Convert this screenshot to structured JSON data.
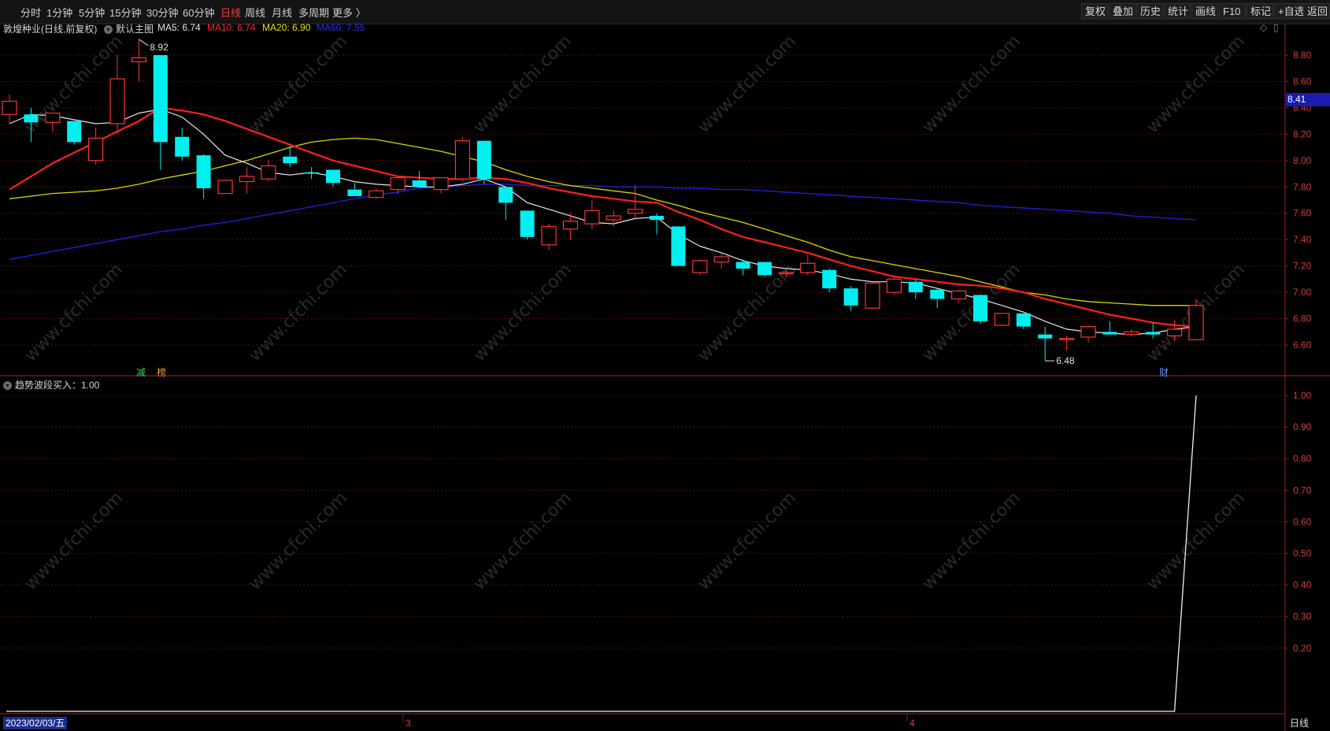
{
  "toolbar": {
    "periods": [
      "分时",
      "1分钟",
      "5分钟",
      "15分钟",
      "30分钟",
      "60分钟",
      "日线",
      "周线",
      "月线",
      "多周期",
      "更多 〉"
    ],
    "active_period": "日线",
    "right_buttons": [
      "复权",
      "叠加",
      "历史",
      "统计",
      "画线",
      "F10",
      "标记",
      "+自选",
      "返回"
    ]
  },
  "main_panel": {
    "stock_title": "敦煌种业(日线,前复权)",
    "indicator_name": "默认主图",
    "ma_labels": [
      {
        "text": "MA5: 6.74",
        "color": "#e8e8e8"
      },
      {
        "text": "MA10: 6.74",
        "color": "#ff2a2a"
      },
      {
        "text": "MA20: 6.90",
        "color": "#e6e600"
      },
      {
        "text": "MA60: 7.55",
        "color": "#2a2aff"
      }
    ],
    "y_ticks": [
      "8.80",
      "8.60",
      "8.40",
      "8.20",
      "8.00",
      "7.80",
      "7.60",
      "7.40",
      "7.20",
      "7.00",
      "6.80",
      "6.60"
    ],
    "current_price": "8.41",
    "high_label": "8.92",
    "low_label": "6.48",
    "badges": [
      {
        "text": "减",
        "color": "#3ecf5a"
      },
      {
        "text": "榜",
        "color": "#e89a3a"
      },
      {
        "text": "财",
        "color": "#6a8cff"
      }
    ]
  },
  "sub_panel": {
    "indicator_label": "趋势波段买入：1.00",
    "y_ticks": [
      "1.00",
      "0.90",
      "0.80",
      "0.70",
      "0.60",
      "0.50",
      "0.40",
      "0.30",
      "0.20"
    ]
  },
  "x_axis": {
    "current_date": "2023/02/03/五",
    "month_labels": [
      "3",
      "4"
    ],
    "period_label": "日线"
  },
  "watermark": "www.cfchi.com",
  "chart_data": {
    "type": "candlestick",
    "candles": [
      {
        "o": 8.35,
        "h": 8.5,
        "l": 8.28,
        "c": 8.45
      },
      {
        "o": 8.35,
        "h": 8.4,
        "l": 8.14,
        "c": 8.29
      },
      {
        "o": 8.29,
        "h": 8.36,
        "l": 8.22,
        "c": 8.36
      },
      {
        "o": 8.3,
        "h": 8.3,
        "l": 8.12,
        "c": 8.14
      },
      {
        "o": 8.0,
        "h": 8.25,
        "l": 7.97,
        "c": 8.17
      },
      {
        "o": 8.28,
        "h": 8.8,
        "l": 8.2,
        "c": 8.62
      },
      {
        "o": 8.75,
        "h": 8.92,
        "l": 8.6,
        "c": 8.78
      },
      {
        "o": 8.8,
        "h": 8.8,
        "l": 7.93,
        "c": 8.14
      },
      {
        "o": 8.18,
        "h": 8.25,
        "l": 8.0,
        "c": 8.03
      },
      {
        "o": 8.04,
        "h": 8.05,
        "l": 7.71,
        "c": 7.79
      },
      {
        "o": 7.75,
        "h": 7.85,
        "l": 7.75,
        "c": 7.85
      },
      {
        "o": 7.84,
        "h": 7.95,
        "l": 7.75,
        "c": 7.88
      },
      {
        "o": 7.86,
        "h": 8.0,
        "l": 7.84,
        "c": 7.96
      },
      {
        "o": 8.03,
        "h": 8.11,
        "l": 7.95,
        "c": 7.98
      },
      {
        "o": 7.91,
        "h": 7.95,
        "l": 7.86,
        "c": 7.9
      },
      {
        "o": 7.93,
        "h": 7.93,
        "l": 7.8,
        "c": 7.83
      },
      {
        "o": 7.78,
        "h": 7.83,
        "l": 7.75,
        "c": 7.73
      },
      {
        "o": 7.72,
        "h": 7.79,
        "l": 7.71,
        "c": 7.77
      },
      {
        "o": 7.78,
        "h": 7.88,
        "l": 7.75,
        "c": 7.87
      },
      {
        "o": 7.85,
        "h": 7.92,
        "l": 7.82,
        "c": 7.8
      },
      {
        "o": 7.78,
        "h": 7.87,
        "l": 7.75,
        "c": 7.87
      },
      {
        "o": 7.86,
        "h": 8.18,
        "l": 7.84,
        "c": 8.15
      },
      {
        "o": 8.15,
        "h": 8.15,
        "l": 7.82,
        "c": 7.86
      },
      {
        "o": 7.8,
        "h": 7.8,
        "l": 7.55,
        "c": 7.68
      },
      {
        "o": 7.62,
        "h": 7.62,
        "l": 7.4,
        "c": 7.42
      },
      {
        "o": 7.36,
        "h": 7.52,
        "l": 7.32,
        "c": 7.5
      },
      {
        "o": 7.48,
        "h": 7.6,
        "l": 7.4,
        "c": 7.54
      },
      {
        "o": 7.52,
        "h": 7.7,
        "l": 7.48,
        "c": 7.62
      },
      {
        "o": 7.55,
        "h": 7.62,
        "l": 7.5,
        "c": 7.58
      },
      {
        "o": 7.6,
        "h": 7.81,
        "l": 7.55,
        "c": 7.63
      },
      {
        "o": 7.58,
        "h": 7.6,
        "l": 7.44,
        "c": 7.55
      },
      {
        "o": 7.5,
        "h": 7.5,
        "l": 7.2,
        "c": 7.2
      },
      {
        "o": 7.15,
        "h": 7.25,
        "l": 7.13,
        "c": 7.24
      },
      {
        "o": 7.23,
        "h": 7.3,
        "l": 7.18,
        "c": 7.27
      },
      {
        "o": 7.23,
        "h": 7.25,
        "l": 7.13,
        "c": 7.18
      },
      {
        "o": 7.23,
        "h": 7.23,
        "l": 7.12,
        "c": 7.13
      },
      {
        "o": 7.15,
        "h": 7.17,
        "l": 7.11,
        "c": 7.15
      },
      {
        "o": 7.15,
        "h": 7.29,
        "l": 7.13,
        "c": 7.22
      },
      {
        "o": 7.17,
        "h": 7.18,
        "l": 7.0,
        "c": 7.03
      },
      {
        "o": 7.03,
        "h": 7.05,
        "l": 6.86,
        "c": 6.9
      },
      {
        "o": 6.88,
        "h": 7.07,
        "l": 6.88,
        "c": 7.07
      },
      {
        "o": 7.0,
        "h": 7.12,
        "l": 6.98,
        "c": 7.1
      },
      {
        "o": 7.08,
        "h": 7.1,
        "l": 6.95,
        "c": 7.0
      },
      {
        "o": 7.02,
        "h": 7.03,
        "l": 6.88,
        "c": 6.95
      },
      {
        "o": 6.95,
        "h": 7.02,
        "l": 6.92,
        "c": 7.01
      },
      {
        "o": 6.98,
        "h": 6.98,
        "l": 6.76,
        "c": 6.78
      },
      {
        "o": 6.75,
        "h": 6.84,
        "l": 6.74,
        "c": 6.84
      },
      {
        "o": 6.84,
        "h": 6.84,
        "l": 6.72,
        "c": 6.74
      },
      {
        "o": 6.68,
        "h": 6.74,
        "l": 6.48,
        "c": 6.65
      },
      {
        "o": 6.65,
        "h": 6.67,
        "l": 6.56,
        "c": 6.65
      },
      {
        "o": 6.66,
        "h": 6.75,
        "l": 6.62,
        "c": 6.74
      },
      {
        "o": 6.7,
        "h": 6.78,
        "l": 6.68,
        "c": 6.68
      },
      {
        "o": 6.68,
        "h": 6.72,
        "l": 6.67,
        "c": 6.7
      },
      {
        "o": 6.7,
        "h": 6.77,
        "l": 6.65,
        "c": 6.68
      },
      {
        "o": 6.67,
        "h": 6.79,
        "l": 6.63,
        "c": 6.72
      },
      {
        "o": 6.64,
        "h": 6.95,
        "l": 6.64,
        "c": 6.9
      }
    ],
    "ma5": [
      8.28,
      8.35,
      8.34,
      8.31,
      8.28,
      8.29,
      8.36,
      8.39,
      8.33,
      8.2,
      8.04,
      7.98,
      7.91,
      7.89,
      7.91,
      7.88,
      7.84,
      7.82,
      7.81,
      7.8,
      7.8,
      7.82,
      7.86,
      7.8,
      7.68,
      7.63,
      7.58,
      7.53,
      7.52,
      7.56,
      7.57,
      7.44,
      7.35,
      7.3,
      7.24,
      7.2,
      7.18,
      7.17,
      7.14,
      7.1,
      7.08,
      7.08,
      7.07,
      7.03,
      6.99,
      6.95,
      6.9,
      6.85,
      6.78,
      6.72,
      6.7,
      6.69,
      6.68,
      6.69,
      6.72,
      6.74
    ],
    "ma10": [
      7.78,
      7.88,
      7.98,
      8.06,
      8.14,
      8.22,
      8.3,
      8.4,
      8.38,
      8.35,
      8.3,
      8.24,
      8.18,
      8.12,
      8.06,
      8.0,
      7.96,
      7.92,
      7.88,
      7.87,
      7.86,
      7.86,
      7.87,
      7.86,
      7.83,
      7.79,
      7.76,
      7.73,
      7.71,
      7.69,
      7.68,
      7.61,
      7.55,
      7.48,
      7.42,
      7.38,
      7.34,
      7.3,
      7.25,
      7.2,
      7.16,
      7.12,
      7.1,
      7.08,
      7.06,
      7.05,
      7.03,
      7.0,
      6.95,
      6.91,
      6.87,
      6.83,
      6.8,
      6.77,
      6.75,
      6.74
    ],
    "ma20": [
      7.71,
      7.73,
      7.75,
      7.76,
      7.77,
      7.79,
      7.82,
      7.86,
      7.89,
      7.92,
      7.96,
      8.0,
      8.05,
      8.1,
      8.14,
      8.16,
      8.17,
      8.16,
      8.13,
      8.1,
      8.07,
      8.03,
      7.99,
      7.93,
      7.88,
      7.84,
      7.81,
      7.79,
      7.77,
      7.75,
      7.7,
      7.66,
      7.61,
      7.57,
      7.53,
      7.48,
      7.43,
      7.38,
      7.32,
      7.27,
      7.24,
      7.21,
      7.18,
      7.15,
      7.12,
      7.08,
      7.04,
      7.0,
      6.98,
      6.95,
      6.93,
      6.92,
      6.91,
      6.9,
      6.9,
      6.9
    ],
    "ma60": [
      7.25,
      7.28,
      7.31,
      7.34,
      7.37,
      7.4,
      7.43,
      7.46,
      7.48,
      7.51,
      7.53,
      7.56,
      7.59,
      7.62,
      7.65,
      7.68,
      7.71,
      7.74,
      7.76,
      7.79,
      7.8,
      7.81,
      7.82,
      7.82,
      7.81,
      7.81,
      7.81,
      7.81,
      7.8,
      7.8,
      7.8,
      7.79,
      7.79,
      7.78,
      7.78,
      7.77,
      7.76,
      7.75,
      7.74,
      7.73,
      7.72,
      7.71,
      7.7,
      7.69,
      7.68,
      7.66,
      7.65,
      7.64,
      7.63,
      7.62,
      7.61,
      7.6,
      7.58,
      7.57,
      7.56,
      7.55
    ],
    "sub_signal": [
      0,
      0,
      0,
      0,
      0,
      0,
      0,
      0,
      0,
      0,
      0,
      0,
      0,
      0,
      0,
      0,
      0,
      0,
      0,
      0,
      0,
      0,
      0,
      0,
      0,
      0,
      0,
      0,
      0,
      0,
      0,
      0,
      0,
      0,
      0,
      0,
      0,
      0,
      0,
      0,
      0,
      0,
      0,
      0,
      0,
      0,
      0,
      0,
      0,
      0,
      0,
      0,
      0,
      0,
      0,
      1.0
    ],
    "price_axis": {
      "min": 6.35,
      "max": 8.97
    },
    "sub_axis": {
      "min": 0,
      "max": 1.0
    }
  }
}
